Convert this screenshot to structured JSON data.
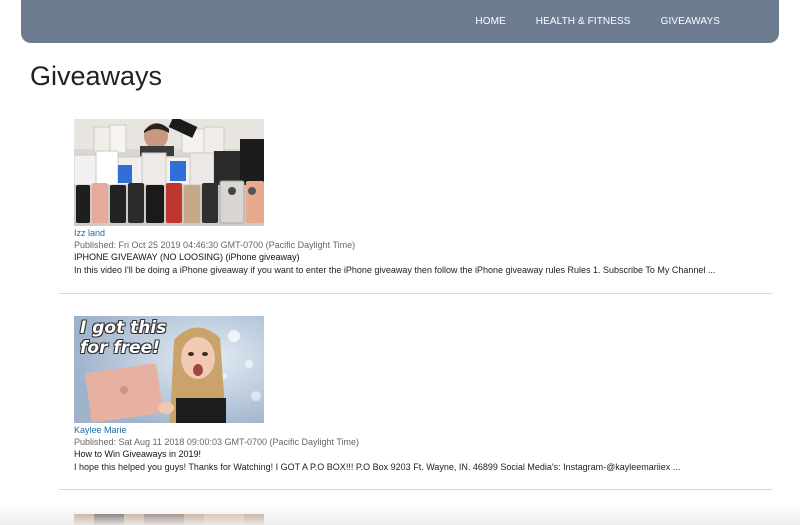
{
  "nav": {
    "items": [
      "HOME",
      "HEALTH & FITNESS",
      "GIVEAWAYS"
    ]
  },
  "page": {
    "title": "Giveaways"
  },
  "videos": [
    {
      "channel": "Izz land",
      "published": "Published: Fri Oct 25 2019 04:46:30 GMT-0700 (Pacific Daylight Time)",
      "title": "IPHONE GIVEAWAY (NO LOOSING) (iPhone giveaway)",
      "description": "In this video I'll be doing a iPhone giveaway if you want to enter the iPhone giveaway then follow the iPhone giveaway rules Rules 1. Subscribe To My Channel ..."
    },
    {
      "channel": "Kaylee Marie",
      "published": "Published: Sat Aug 11 2018 09:00:03 GMT-0700 (Pacific Daylight Time)",
      "title": "How to Win Giveaways in 2019!",
      "description": "I hope this helped you guys! Thanks for Watching! I GOT A P.O BOX!!! P.O Box 9203 Ft. Wayne, IN. 46899 Social Media's: Instagram-@kayleemariiex ...",
      "thumb_caption": [
        "I got this",
        "for free!"
      ]
    }
  ],
  "colors": {
    "navbar": "#6e7c91",
    "link": "#1a6aa8"
  }
}
